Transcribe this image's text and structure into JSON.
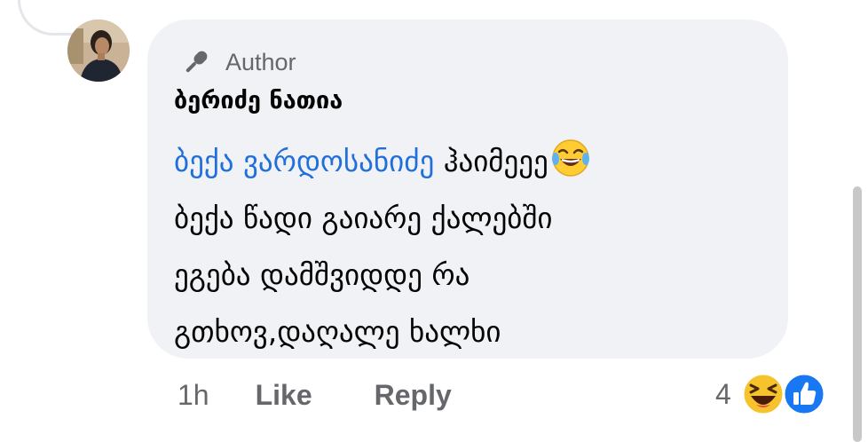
{
  "comment": {
    "badge_label": "Author",
    "badge_icon": "microphone-icon",
    "author_name": "ბერიძე ნათია",
    "mention": "ბექა ვარდოსანიძე",
    "line1_rest": " ჰაიმეეე",
    "line1_emoji": "laughing-tears-emoji",
    "line2": "ბექა წადი გაიარე ქალებში",
    "line3": "ეგება დამშვიდდე რა",
    "line4": "გთხოვ,დაღალე ხალხი",
    "mention_color": "#216fdb"
  },
  "actions": {
    "time": "1h",
    "like_label": "Like",
    "reply_label": "Reply"
  },
  "reactions": {
    "count": "4",
    "icons": [
      "haha-reaction-icon",
      "like-reaction-icon"
    ],
    "like_color": "#1877f2",
    "haha_color": "#f7c32c"
  }
}
